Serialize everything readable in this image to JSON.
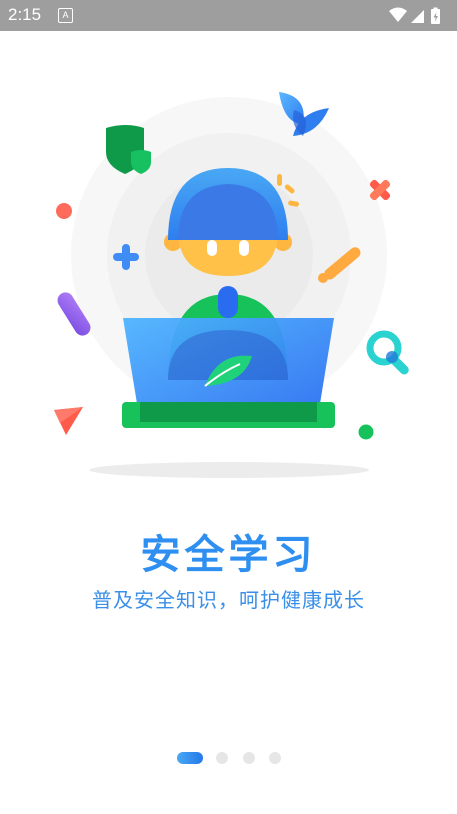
{
  "status_bar": {
    "time": "2:15",
    "notification_icon_letter": "A",
    "icons": [
      "wifi-icon",
      "signal-icon",
      "battery-charging-icon"
    ]
  },
  "onboarding": {
    "title": "安全学习",
    "subtitle": "普及安全知识，呵护健康成长",
    "illustration": "person-with-laptop-illustration",
    "pager": {
      "total_pages": 4,
      "current_page": 1
    }
  },
  "colors": {
    "accent": "#2f8ff0",
    "subtitle": "#3a8fe8",
    "status_bar": "#9e9e9e",
    "green": "#15c06a",
    "pager_inactive": "#e6e6e6"
  }
}
